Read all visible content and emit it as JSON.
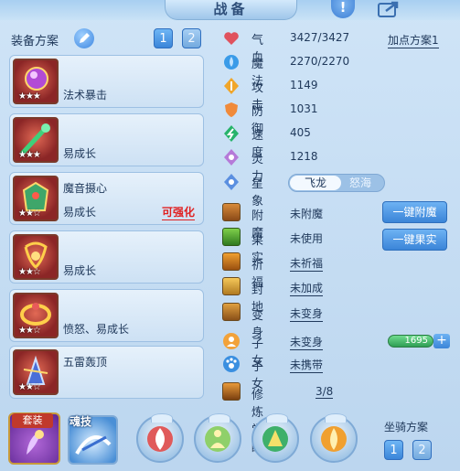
{
  "header": {
    "title": "战备",
    "help_label": "!"
  },
  "equipment_panel": {
    "label": "装备方案",
    "schemes": [
      "1",
      "2"
    ],
    "items": [
      {
        "name": "法术暴击",
        "trait": "",
        "enhance": "",
        "stars": "★★★"
      },
      {
        "name": "",
        "trait": "易成长",
        "enhance": "",
        "stars": "★★★"
      },
      {
        "name": "魔音摄心",
        "trait": "易成长",
        "enhance": "可强化",
        "stars": "★★☆"
      },
      {
        "name": "",
        "trait": "易成长",
        "enhance": "",
        "stars": "★★☆"
      },
      {
        "name": "",
        "trait": "愤怒、易成长",
        "enhance": "",
        "stars": "★★☆"
      },
      {
        "name": "五雷轰顶",
        "trait": "",
        "enhance": "",
        "stars": "★★☆"
      }
    ]
  },
  "stats": {
    "add_points_label": "加点方案1",
    "rows": [
      {
        "label": "气血",
        "value": "3427/3427",
        "icon": "heart-icon",
        "color": "#e0525e"
      },
      {
        "label": "魔法",
        "value": "2270/2270",
        "icon": "water-drop-icon",
        "color": "#3a9be8"
      },
      {
        "label": "攻击",
        "value": "1149",
        "icon": "sword-icon",
        "color": "#f0a62b"
      },
      {
        "label": "防御",
        "value": "1031",
        "icon": "shield-icon",
        "color": "#f08a3a"
      },
      {
        "label": "速度",
        "value": "405",
        "icon": "speed-icon",
        "color": "#27b36a"
      },
      {
        "label": "灵力",
        "value": "1218",
        "icon": "spirit-icon",
        "color": "#b57ad8"
      }
    ],
    "star_label": "星象",
    "star_options": [
      "飞龙",
      "怒海"
    ]
  },
  "actions": {
    "rows": [
      {
        "label": "附魔",
        "value": "未附魔",
        "underline": false,
        "icon": "enchant-icon"
      },
      {
        "label": "果实",
        "value": "未使用",
        "underline": false,
        "icon": "fruit-icon"
      },
      {
        "label": "祈福",
        "value": "未祈福",
        "underline": true,
        "icon": "pray-icon"
      },
      {
        "label": "封地",
        "value": "未加成",
        "underline": true,
        "icon": "fief-icon"
      },
      {
        "label": "变身",
        "value": "未变身",
        "underline": true,
        "icon": "transform-icon"
      },
      {
        "label": "子女",
        "value": "未变身",
        "underline": true,
        "icon": "child-icon"
      },
      {
        "label": "子女",
        "value": "未携带",
        "underline": true,
        "icon": "child-paw-icon"
      },
      {
        "label": "修炼觉醒",
        "value": "3/8",
        "underline": true,
        "icon": "cultivation-icon"
      }
    ],
    "enchant_button": "一键附魔",
    "fruit_button": "一键果实",
    "bar_value": "1695",
    "plus_label": "+"
  },
  "bottom": {
    "suit_label": "套装",
    "soul_label": "魂技",
    "mount_label": "坐骑方案",
    "mount_schemes": [
      "1",
      "2"
    ]
  }
}
